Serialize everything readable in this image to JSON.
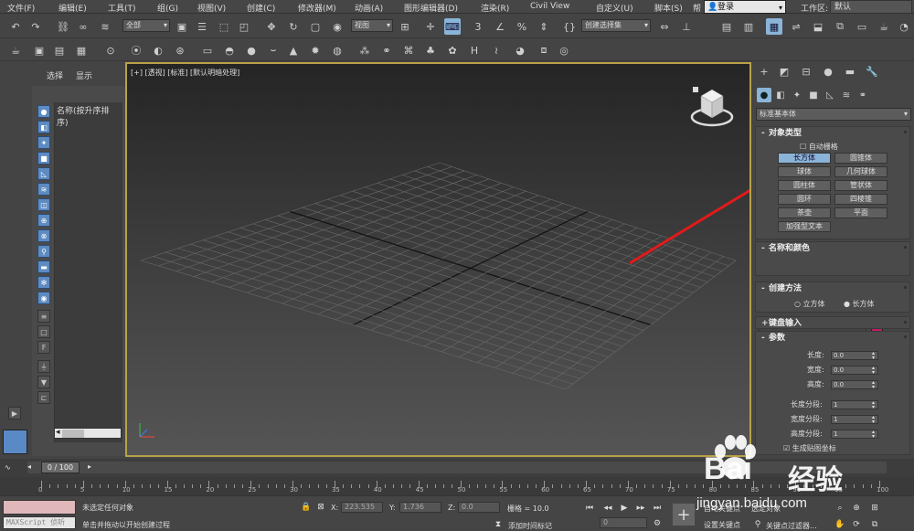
{
  "menu": [
    "文件(F)",
    "编辑(E)",
    "工具(T)",
    "组(G)",
    "视图(V)",
    "创建(C)",
    "修改器(M)",
    "动画(A)",
    "图形编辑器(D)",
    "渲染(R)",
    "Civil View",
    "自定义(U)",
    "脚本(S)"
  ],
  "menu_help": "帮",
  "login": "登录",
  "workspace_label": "工作区:",
  "workspace": "默认",
  "toolbar": {
    "filter": "全部",
    "view": "视图",
    "selection_set": "创建选择集"
  },
  "left": {
    "tab_select": "选择",
    "tab_display": "显示",
    "list_header": "名称(按升序排序)"
  },
  "viewport": {
    "label": "[+] [透视] [标准] [默认明暗处理]"
  },
  "cmd": {
    "category": "标准基本体",
    "object_type": "对象类型",
    "autogrid": "自动栅格",
    "buttons": [
      "长方体",
      "圆锥体",
      "球体",
      "几何球体",
      "圆柱体",
      "管状体",
      "圆环",
      "四棱锥",
      "茶壶",
      "平面",
      "加强型文本"
    ],
    "name_color": "名称和颜色",
    "create_method": "创建方法",
    "method_cube": "立方体",
    "method_box": "长方体",
    "keyboard": "键盘输入",
    "params": "参数",
    "length": "长度:",
    "width": "宽度:",
    "height": "高度:",
    "length_val": "0.0",
    "width_val": "0.0",
    "height_val": "0.0",
    "lseg": "长度分段:",
    "wseg": "宽度分段:",
    "hseg": "高度分段:",
    "lseg_val": "1",
    "wseg_val": "1",
    "hseg_val": "1",
    "gen_map": "生成贴图坐标",
    "swatch_color": "#c01c6c"
  },
  "time": {
    "slider": "0 / 100",
    "ticks": [
      "0",
      "5",
      "10",
      "15",
      "20",
      "25",
      "30",
      "35",
      "40",
      "45",
      "50",
      "55",
      "60",
      "65",
      "70",
      "75",
      "80",
      "85",
      "90",
      "95",
      "100"
    ]
  },
  "status": {
    "maxscript": "MAXScript 侦听",
    "msg1": "未选定任何对象",
    "msg2": "单击并拖动以开始创建过程",
    "x_label": "X:",
    "x_val": "223.535",
    "y_label": "Y:",
    "y_val": "1.736",
    "z_label": "Z:",
    "z_val": "0.0",
    "grid": "栅格 = 10.0",
    "add_tag": "添加时间标记",
    "auto_key": "自动关键点",
    "selected": "选定对象",
    "set_key": "设置关键点",
    "key_filter": "关键点过滤器...",
    "frame": "0"
  },
  "watermark": {
    "brand": "Bai",
    "brand_cn": "经验",
    "url": "jingyan.baidu.com"
  }
}
